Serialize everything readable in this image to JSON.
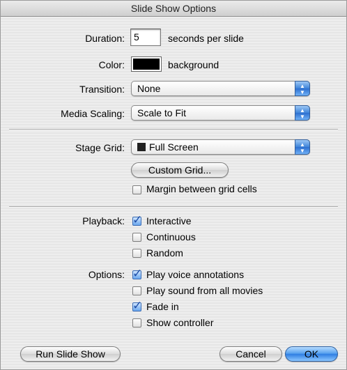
{
  "window": {
    "title": "Slide Show Options"
  },
  "duration": {
    "label": "Duration:",
    "value": "5",
    "suffix": "seconds per slide"
  },
  "color": {
    "label": "Color:",
    "swatch": "#000000",
    "suffix": "background"
  },
  "transition": {
    "label": "Transition:",
    "selected": "None"
  },
  "media_scaling": {
    "label": "Media Scaling:",
    "selected": "Scale to Fit"
  },
  "stage_grid": {
    "label": "Stage Grid:",
    "selected": "Full Screen"
  },
  "custom_grid_button": "Custom Grid...",
  "margin_checkbox": {
    "label": "Margin between grid cells",
    "checked": false
  },
  "playback": {
    "label": "Playback:",
    "options": [
      {
        "label": "Interactive",
        "checked": true
      },
      {
        "label": "Continuous",
        "checked": false
      },
      {
        "label": "Random",
        "checked": false
      }
    ]
  },
  "options": {
    "label": "Options:",
    "items": [
      {
        "label": "Play voice annotations",
        "checked": true
      },
      {
        "label": "Play sound from all movies",
        "checked": false
      },
      {
        "label": "Fade in",
        "checked": true
      },
      {
        "label": "Show controller",
        "checked": false
      }
    ]
  },
  "buttons": {
    "run": "Run Slide Show",
    "cancel": "Cancel",
    "ok": "OK"
  }
}
